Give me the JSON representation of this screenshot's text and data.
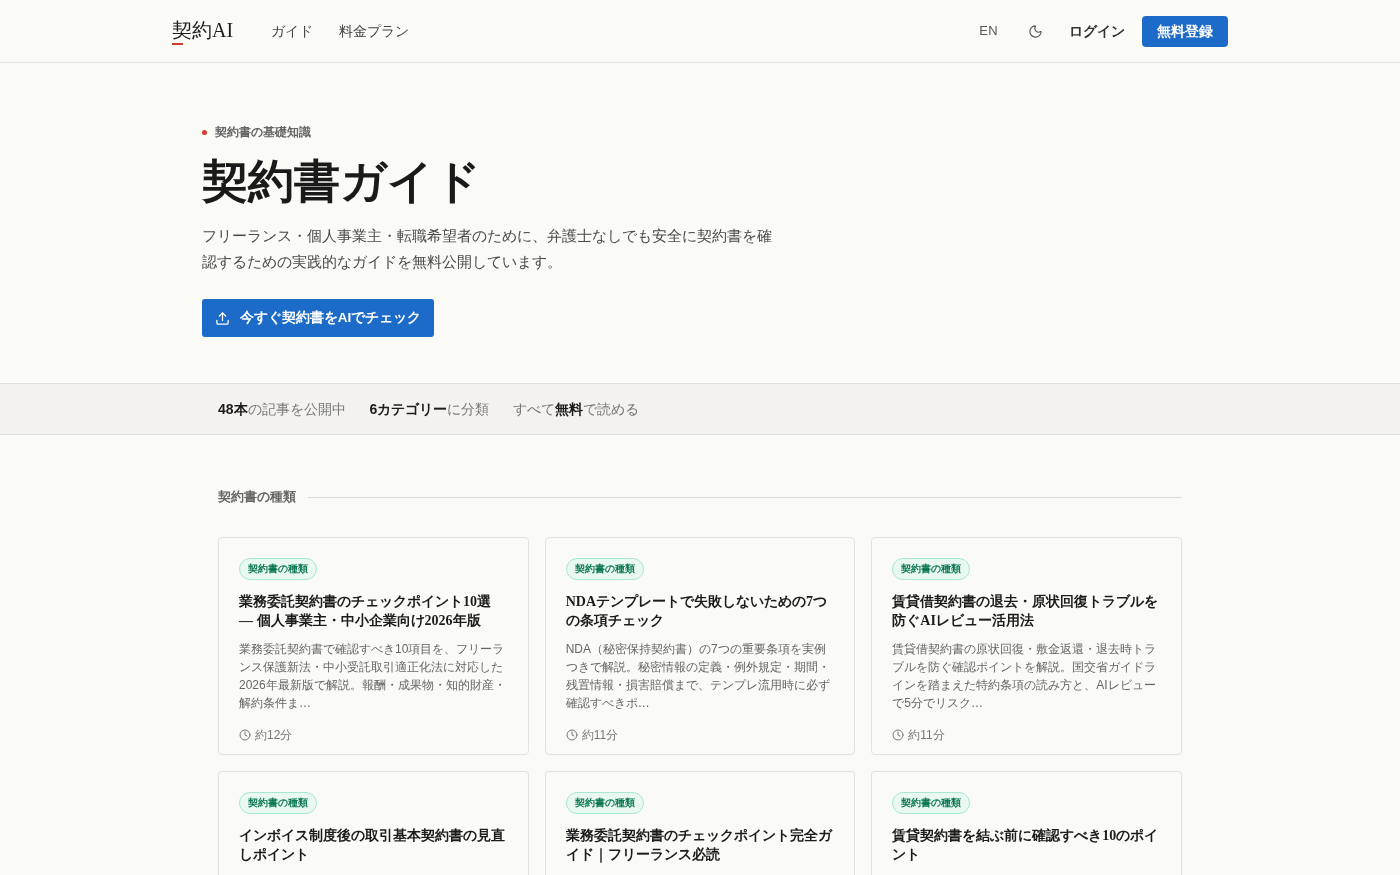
{
  "header": {
    "logo": "契約AI",
    "nav": [
      {
        "label": "ガイド"
      },
      {
        "label": "料金プラン"
      }
    ],
    "language": "EN",
    "login": "ログイン",
    "signup": "無料登録"
  },
  "hero": {
    "eyebrow": "契約書の基礎知識",
    "title": "契約書ガイド",
    "description": "フリーランス・個人事業主・転職希望者のために、弁護士なしでも安全に契約書を確認するための実践的なガイドを無料公開しています。",
    "cta": "今すぐ契約書をAIでチェック"
  },
  "stats": [
    "**48本**の記事を公開中",
    "**6カテゴリー**に分類",
    "すべて**無料**で読める"
  ],
  "section": {
    "heading": "契約書の種類",
    "articles": [
      {
        "tag": "契約書の種類",
        "title": "業務委託契約書のチェックポイント10選 — 個人事業主・中小企業向け2026年版",
        "description": "業務委託契約書で確認すべき10項目を、フリーランス保護新法・中小受託取引適正化法に対応した2026年最新版で解説。報酬・成果物・知的財産・解約条件ま…",
        "read_time": "約12分"
      },
      {
        "tag": "契約書の種類",
        "title": "NDAテンプレートで失敗しないための7つの条項チェック",
        "description": "NDA（秘密保持契約書）の7つの重要条項を実例つきで解説。秘密情報の定義・例外規定・期間・残置情報・損害賠償まで、テンプレ流用時に必ず確認すべきポ…",
        "read_time": "約11分"
      },
      {
        "tag": "契約書の種類",
        "title": "賃貸借契約書の退去・原状回復トラブルを防ぐAIレビュー活用法",
        "description": "賃貸借契約書の原状回復・敷金返還・退去時トラブルを防ぐ確認ポイントを解説。国交省ガイドラインを踏まえた特約条項の読み方と、AIレビューで5分でリスク…",
        "read_time": "約11分"
      },
      {
        "tag": "契約書の種類",
        "title": "インボイス制度後の取引基本契約書の見直しポイント"
      },
      {
        "tag": "契約書の種類",
        "title": "業務委託契約書のチェックポイント完全ガイド｜フリーランス必読"
      },
      {
        "tag": "契約書の種類",
        "title": "賃貸契約書を結ぶ前に確認すべき10のポイント"
      }
    ]
  }
}
